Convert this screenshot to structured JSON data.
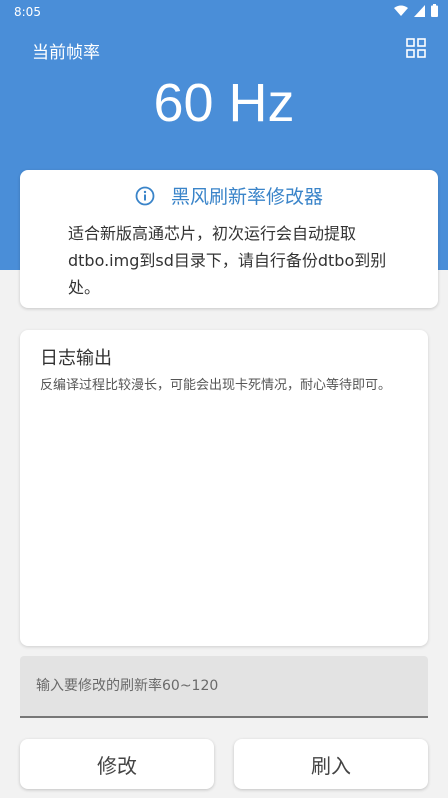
{
  "status_bar": {
    "time": "8:05",
    "icons": [
      "wifi-icon",
      "signal-icon",
      "battery-icon"
    ]
  },
  "header": {
    "fps_label": "当前帧率",
    "fps_value": "60 Hz",
    "menu_icon": "grid-icon",
    "color": "#4a8ed8"
  },
  "info_card": {
    "icon": "info-icon",
    "title": "黑风刷新率修改器",
    "description": "适合新版高通芯片，初次运行会自动提取dtbo.img到sd目录下，请自行备份dtbo到别处。",
    "title_color": "#3a84c9"
  },
  "log_card": {
    "title": "日志输出",
    "text": "反编译过程比较漫长，可能会出现卡死情况，耐心等待即可。"
  },
  "input": {
    "placeholder": "输入要修改的刷新率60~120",
    "value": ""
  },
  "buttons": {
    "modify_label": "修改",
    "flash_label": "刷入"
  }
}
